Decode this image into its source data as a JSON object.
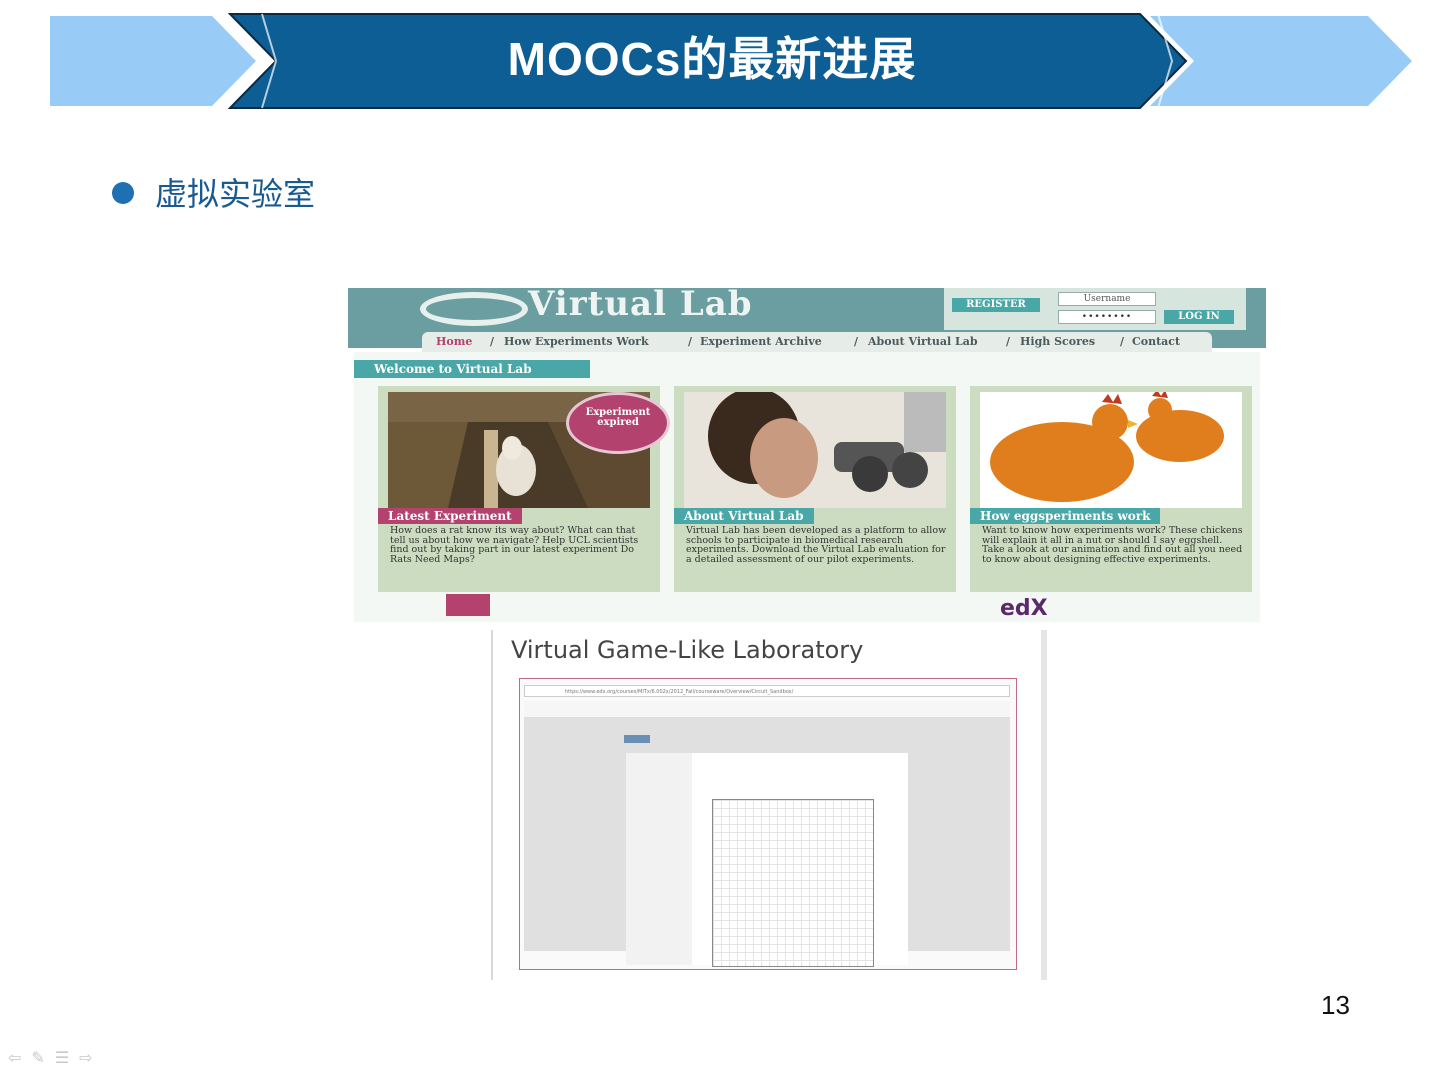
{
  "slide": {
    "title": "MOOCs的最新进展",
    "bullet": "虚拟实验室",
    "page_number": "13",
    "colors": {
      "banner_dark": "#0d5e94",
      "banner_light": "#99cbf7",
      "bullet": "#1f6fb3"
    }
  },
  "virtual_lab": {
    "logo": "Virtual Lab",
    "register": "REGISTER",
    "username_placeholder": "Username",
    "password_mask": "••••••••",
    "login": "LOG IN",
    "nav": [
      "Home",
      "/",
      "How Experiments Work",
      "/",
      "Experiment Archive",
      "/",
      "About Virtual Lab",
      "/",
      "High Scores",
      "/",
      "Contact"
    ],
    "welcome": "Welcome to Virtual Lab",
    "cards": [
      {
        "title": "Latest Experiment",
        "text": "How does a rat know its way about? What can that tell us about how we navigate? Help UCL scientists find out by taking part in our latest experiment Do Rats Need Maps?",
        "badge": "Experiment expired"
      },
      {
        "title": "About Virtual Lab",
        "text": "Virtual Lab has been developed as a platform to allow schools to participate in biomedical research experiments. Download the Virtual Lab evaluation for a detailed assessment of our pilot experiments."
      },
      {
        "title": "How eggsperiments work",
        "text": "Want to know how experiments work? These chickens will explain it all in a nut or should I say eggshell. Take a look at our animation and find out all you need to know about designing effective experiments."
      }
    ],
    "edx_logo": "edX"
  },
  "game_lab": {
    "title": "Virtual Game-Like Laboratory",
    "url": "https://www.edx.org/courses/MITx/6.002x/2012_Fall/courseware/Overview/Circuit_Sandbox/"
  }
}
